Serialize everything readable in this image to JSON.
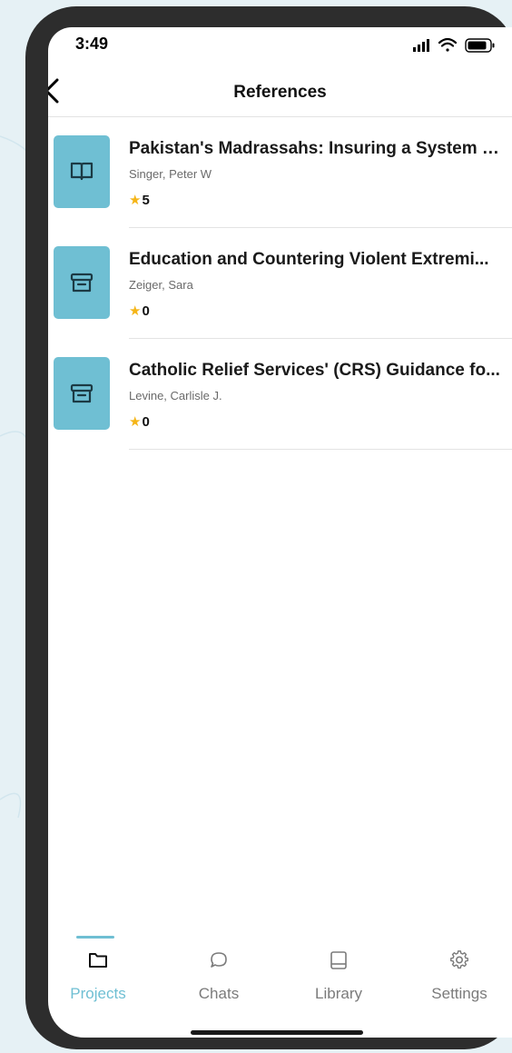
{
  "status_bar": {
    "time": "3:49",
    "icons": [
      "signal-icon",
      "wifi-icon",
      "battery-icon"
    ]
  },
  "nav": {
    "title": "References",
    "back_icon": "chevron-left-icon"
  },
  "references": [
    {
      "title": "Pakistan's Madrassahs: Insuring a System o...",
      "author": "Singer, Peter W",
      "rating": "5",
      "icon": "book-icon"
    },
    {
      "title": "Education and Countering Violent Extremi...",
      "author": "Zeiger, Sara",
      "rating": "0",
      "icon": "archive-icon"
    },
    {
      "title": "Catholic Relief Services' (CRS) Guidance fo...",
      "author": "Levine, Carlisle J.",
      "rating": "0",
      "icon": "archive-icon"
    }
  ],
  "tabs": [
    {
      "label": "Projects",
      "icon": "folder-icon",
      "active": true
    },
    {
      "label": "Chats",
      "icon": "chat-bubble-icon",
      "active": false
    },
    {
      "label": "Library",
      "icon": "library-book-icon",
      "active": false
    },
    {
      "label": "Settings",
      "icon": "gear-icon",
      "active": false
    }
  ],
  "colors": {
    "accent": "#6fbfd3",
    "star": "#f5b517",
    "frame": "#2d2d2d",
    "background": "#e6f1f5"
  }
}
